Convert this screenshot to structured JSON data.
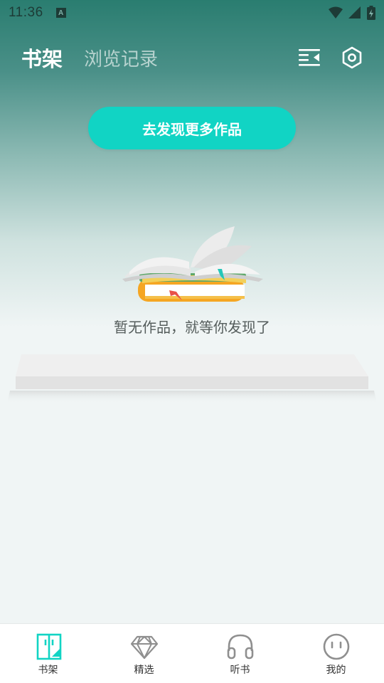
{
  "status_bar": {
    "time": "11:36",
    "notification_icon": "a-icon",
    "icons": [
      "wifi-icon",
      "signal-icon",
      "battery-icon"
    ]
  },
  "header": {
    "tabs": [
      {
        "label": "书架",
        "active": true
      },
      {
        "label": "浏览记录",
        "active": false
      }
    ],
    "icons": [
      "list-sort-icon",
      "settings-hexagon-icon"
    ]
  },
  "main": {
    "discover_button_label": "去发现更多作品",
    "empty_message": "暂无作品，就等你发现了"
  },
  "bottom_nav": {
    "items": [
      {
        "label": "书架",
        "icon": "bookshelf-icon",
        "active": true
      },
      {
        "label": "精选",
        "icon": "diamond-icon",
        "active": false
      },
      {
        "label": "听书",
        "icon": "headphones-icon",
        "active": false
      },
      {
        "label": "我的",
        "icon": "face-icon",
        "active": false
      }
    ]
  },
  "colors": {
    "accent": "#11d4c4",
    "header_gradient_top": "#2a7d70",
    "background": "#f0f5f5"
  }
}
